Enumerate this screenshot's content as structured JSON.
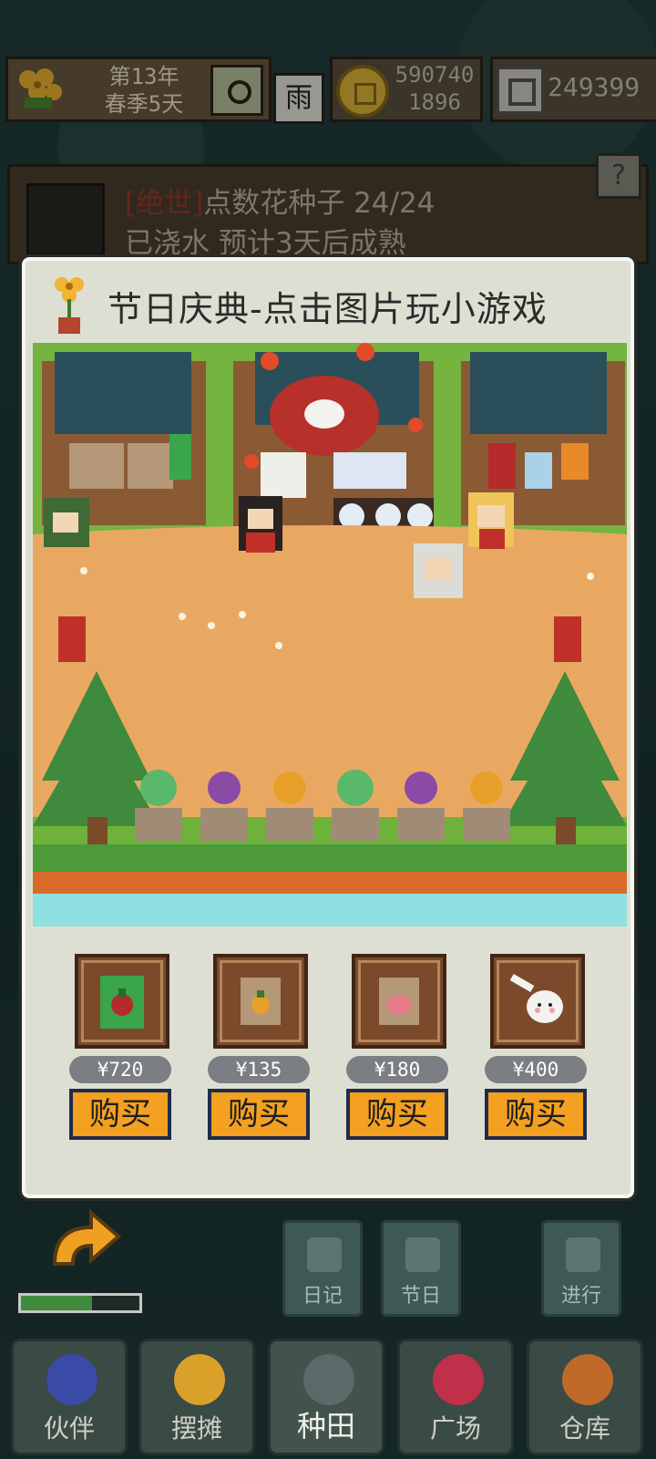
{
  "hud": {
    "year": "第13年",
    "season_day": "春季5天",
    "weather": "雨",
    "coins_line1": "590740",
    "coins_line2": "1896",
    "gems": "249399"
  },
  "quest": {
    "tag": "[绝世]",
    "name": "点数花种子",
    "progress": "24/24",
    "status": "已浇水 预计3天后成熟",
    "help_label": "?"
  },
  "dialog": {
    "title": "节日庆典-点击图片玩小游戏"
  },
  "shop_items": [
    {
      "name": "green-seed-bag",
      "price": "¥720",
      "buy_label": "购买"
    },
    {
      "name": "orange-seed-pack",
      "price": "¥135",
      "buy_label": "购买"
    },
    {
      "name": "pink-seed-pack",
      "price": "¥180",
      "buy_label": "购买"
    },
    {
      "name": "ghost-spoon",
      "price": "¥400",
      "buy_label": "购买"
    }
  ],
  "side_buttons": {
    "diary": "日记",
    "festival": "节日",
    "proceed": "进行"
  },
  "progress_fraction": 0.6,
  "nav": {
    "partner": "伙伴",
    "stall": "摆摊",
    "farm": "种田",
    "plaza": "广场",
    "warehouse": "仓库"
  },
  "colors": {
    "buy_button": "#f4a020",
    "dialog_bg": "#dedfd3",
    "ground": "#e9a862",
    "grass": "#6fb23a"
  }
}
